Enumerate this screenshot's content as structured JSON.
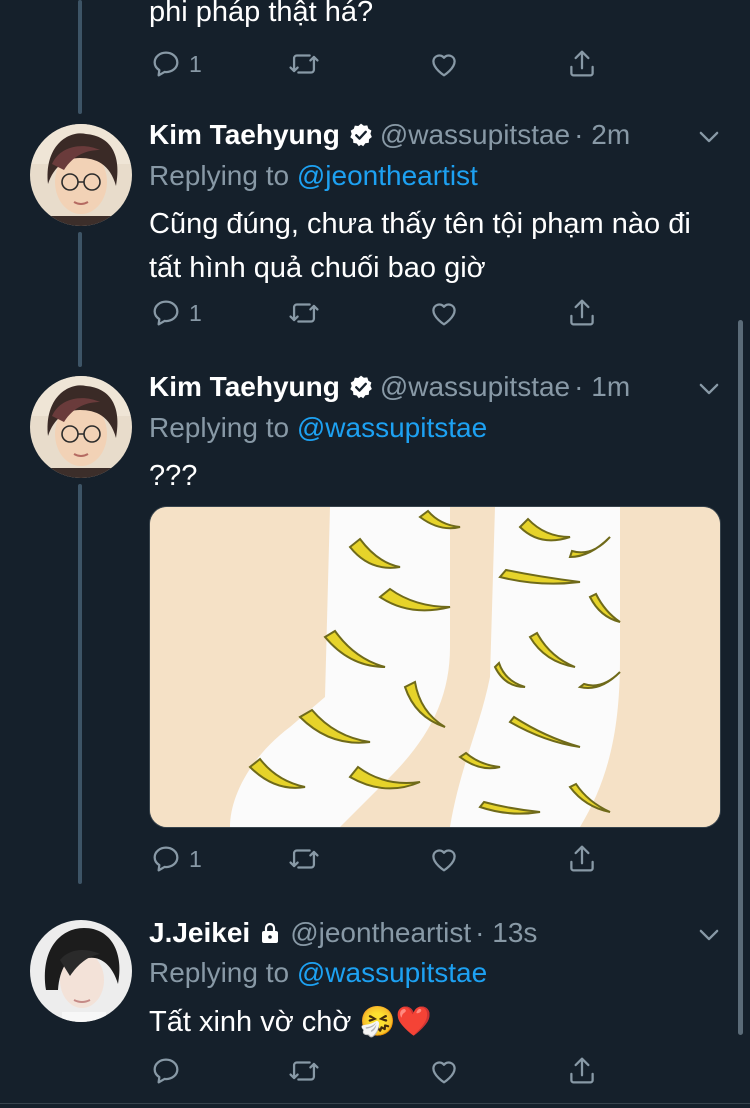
{
  "top_tweet": {
    "text_tail": "phi pháp thật há?",
    "reply_count": "1"
  },
  "tweets": [
    {
      "name": "Kim Taehyung",
      "handle": "@wassupitstae",
      "time": "· 2m",
      "replying_label": "Replying to",
      "replying_to": "@jeontheartist",
      "text": "Cũng đúng, chưa thấy tên tội phạm nào đi tất hình quả chuối bao giờ",
      "reply_count": "1"
    },
    {
      "name": "Kim Taehyung",
      "handle": "@wassupitstae",
      "time": "· 1m",
      "replying_label": "Replying to",
      "replying_to": "@wassupitstae",
      "text": "???",
      "reply_count": "1",
      "media": "banana-socks-photo"
    },
    {
      "name": "J.Jeikei",
      "handle": "@jeontheartist",
      "time": "· 13s",
      "replying_label": "Replying to",
      "replying_to": "@wassupitstae",
      "text": "Tất xinh vờ chờ 🤧❤️",
      "reply_count": ""
    }
  ],
  "colors": {
    "background": "#15202b",
    "secondary_text": "#8899a6",
    "link": "#1da1f2",
    "verified": "#ffffff"
  },
  "icons": [
    "reply-icon",
    "retweet-icon",
    "like-icon",
    "share-icon",
    "verified-badge-icon",
    "lock-icon",
    "chevron-down-icon"
  ]
}
